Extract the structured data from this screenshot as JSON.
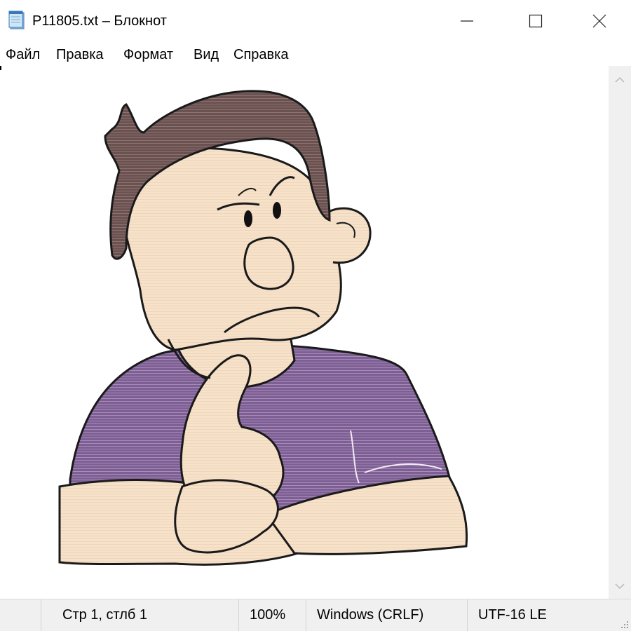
{
  "window": {
    "title": "P11805.txt – Блокнот",
    "icon": "notepad-icon"
  },
  "menu": [
    "Файл",
    "Правка",
    "Формат",
    "Вид",
    "Справка"
  ],
  "status": {
    "position": "Стр 1, стлб 1",
    "zoom": "100%",
    "line_endings": "Windows (CRLF)",
    "encoding": "UTF-16 LE"
  },
  "colors": {
    "hair": "#6b5251",
    "skin": "#f6e1c9",
    "shirt": "#7d5f94",
    "outline": "#1a1a1a"
  }
}
